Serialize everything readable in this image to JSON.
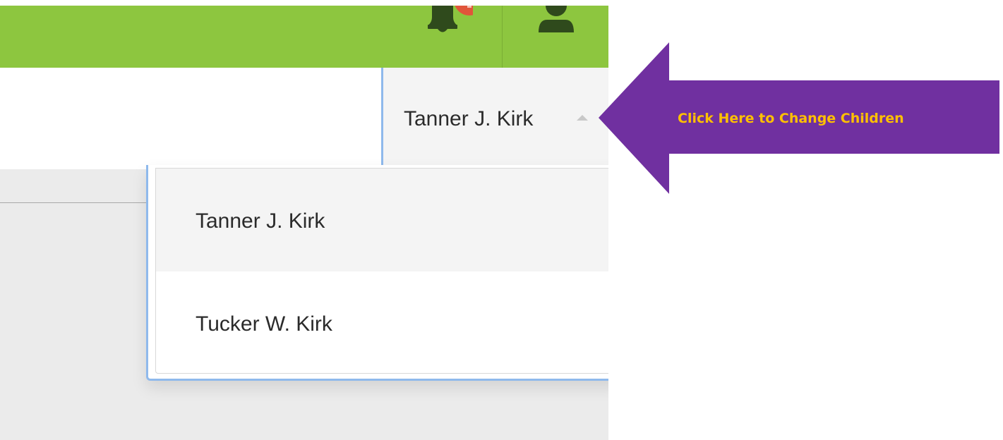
{
  "topbar": {
    "background_color": "#8dc63f",
    "notification_icon": "bell-icon",
    "notification_badge_color": "#e1553a",
    "profile_icon": "user-icon",
    "icon_color": "#2f4a1c"
  },
  "child_selector": {
    "selected_child": "Tanner J. Kirk",
    "caret_icon": "caret-up-icon",
    "focus_color": "#8fb9ec"
  },
  "dropdown": {
    "items": [
      {
        "label": "Tanner J. Kirk",
        "selected": true
      },
      {
        "label": "Tucker W. Kirk",
        "selected": false
      }
    ]
  },
  "annotation": {
    "text": "Click Here to Change Children",
    "arrow_color": "#7030a0",
    "text_color": "#ffc000"
  }
}
